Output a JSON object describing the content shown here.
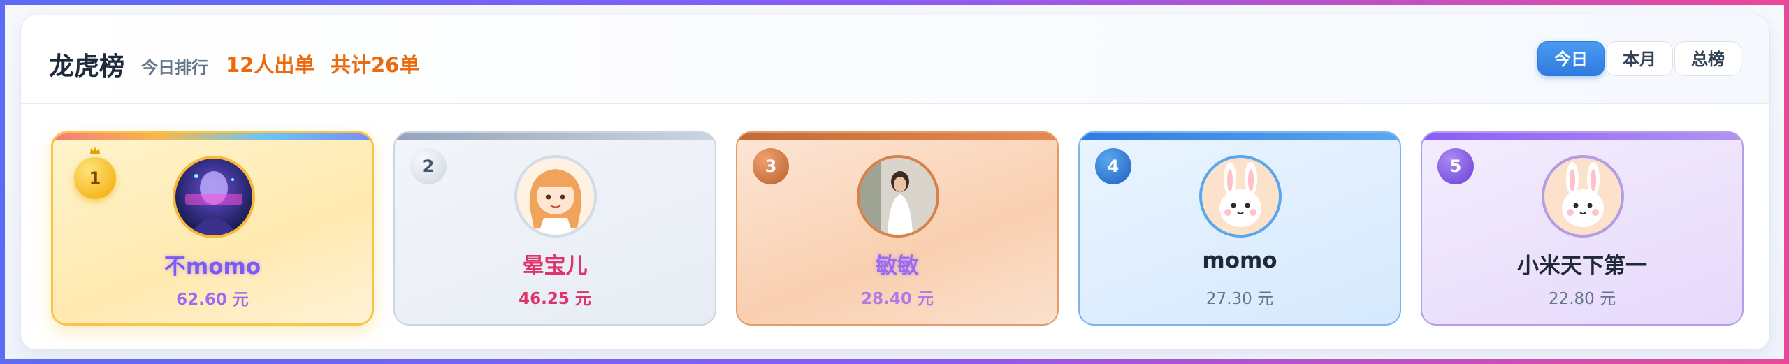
{
  "header": {
    "title": "龙虎榜",
    "subtitle": "今日排行",
    "people_stat": "12人出单",
    "total_stat": "共计26单"
  },
  "tabs": [
    {
      "label": "今日",
      "active": true
    },
    {
      "label": "本月",
      "active": false
    },
    {
      "label": "总榜",
      "active": false
    }
  ],
  "leaderboard": [
    {
      "rank": "1",
      "name": "不momo",
      "amount": "62.60 元",
      "avatar": "anime-girl-avatar"
    },
    {
      "rank": "2",
      "name": "晕宝儿",
      "amount": "46.25 元",
      "avatar": "anime-girl-avatar"
    },
    {
      "rank": "3",
      "name": "敏敏",
      "amount": "28.40 元",
      "avatar": "photo-avatar"
    },
    {
      "rank": "4",
      "name": "momo",
      "amount": "27.30 元",
      "avatar": "bunny-avatar"
    },
    {
      "rank": "5",
      "name": "小米天下第一",
      "amount": "22.80 元",
      "avatar": "bunny-avatar"
    }
  ],
  "colors": {
    "accent": "#2f7be0",
    "stat_orange": "#ea6a0c",
    "gold": "#f7c548",
    "silver": "#cbd5e1",
    "bronze": "#e59a6a",
    "blue": "#7cb4ec",
    "purple": "#b29de6"
  }
}
